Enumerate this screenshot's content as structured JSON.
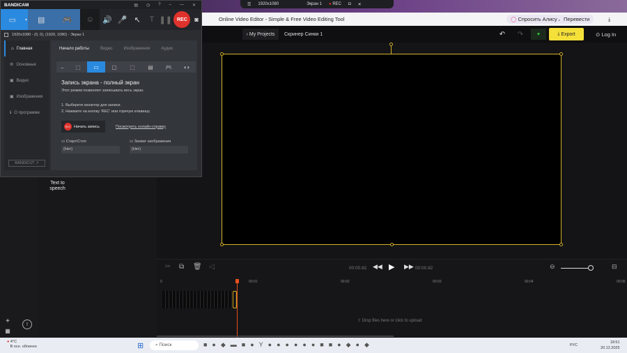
{
  "browser": {
    "recorder_bar": {
      "resolution": "1920x1080",
      "screen": "Экран 1",
      "rec": "REC"
    },
    "page_title": "Online Video Editor - Simple & Free Video Editing Tool",
    "alice": "Спросить Алису AI",
    "translate": "Перевести"
  },
  "editor": {
    "my_projects": "My Projects",
    "project_name": "Скринер Синки 1",
    "export": "Export",
    "login": "Log In",
    "panel_item": "Text to speech",
    "time_current": "00:00.82",
    "time_total": "00:00.82",
    "ruler": [
      "0",
      "00:01",
      "00:02",
      "00:03",
      "00:04",
      "00:05"
    ],
    "drop": "Drop files here or click to upload"
  },
  "bandicam": {
    "logo": "BANDICAM",
    "rec": "REC",
    "target": "1920x1080 - (0, 0), (1920, 1080) - Экран 1",
    "nav": [
      "Главная",
      "Основные",
      "Видео",
      "Изображения",
      "О программе"
    ],
    "tabs": [
      "Начало работы",
      "Видео",
      "Изображения",
      "Аудио"
    ],
    "heading": "Запись экрана - полный экран",
    "desc": "Этот режим позволяет записывать весь экран.",
    "step1": "1. Выберите монитор для записи.",
    "step2": "2. Нажмите на кнопку 'REC' или горячую клавишу.",
    "start": "Начать запись",
    "help": "Посмотреть онлайн-справку",
    "hk1_label": "Старт/Стоп",
    "hk1_value": "(Нет)",
    "hk2_label": "Захват изображения",
    "hk2_value": "(Нет)",
    "bandicut": "BANDICUT ↗"
  },
  "taskbar": {
    "temp": "4°C",
    "weather": "В осн. облачно",
    "search": "Поиск",
    "lang": "РУС",
    "time": "18:51",
    "date": "20.12.2025"
  },
  "colors": {
    "accent_blue": "#2a8ae0",
    "rec_red": "#e0322c",
    "export_yellow": "#f5e03a",
    "canvas_border": "#d4b22a",
    "playhead": "#e8501e"
  }
}
